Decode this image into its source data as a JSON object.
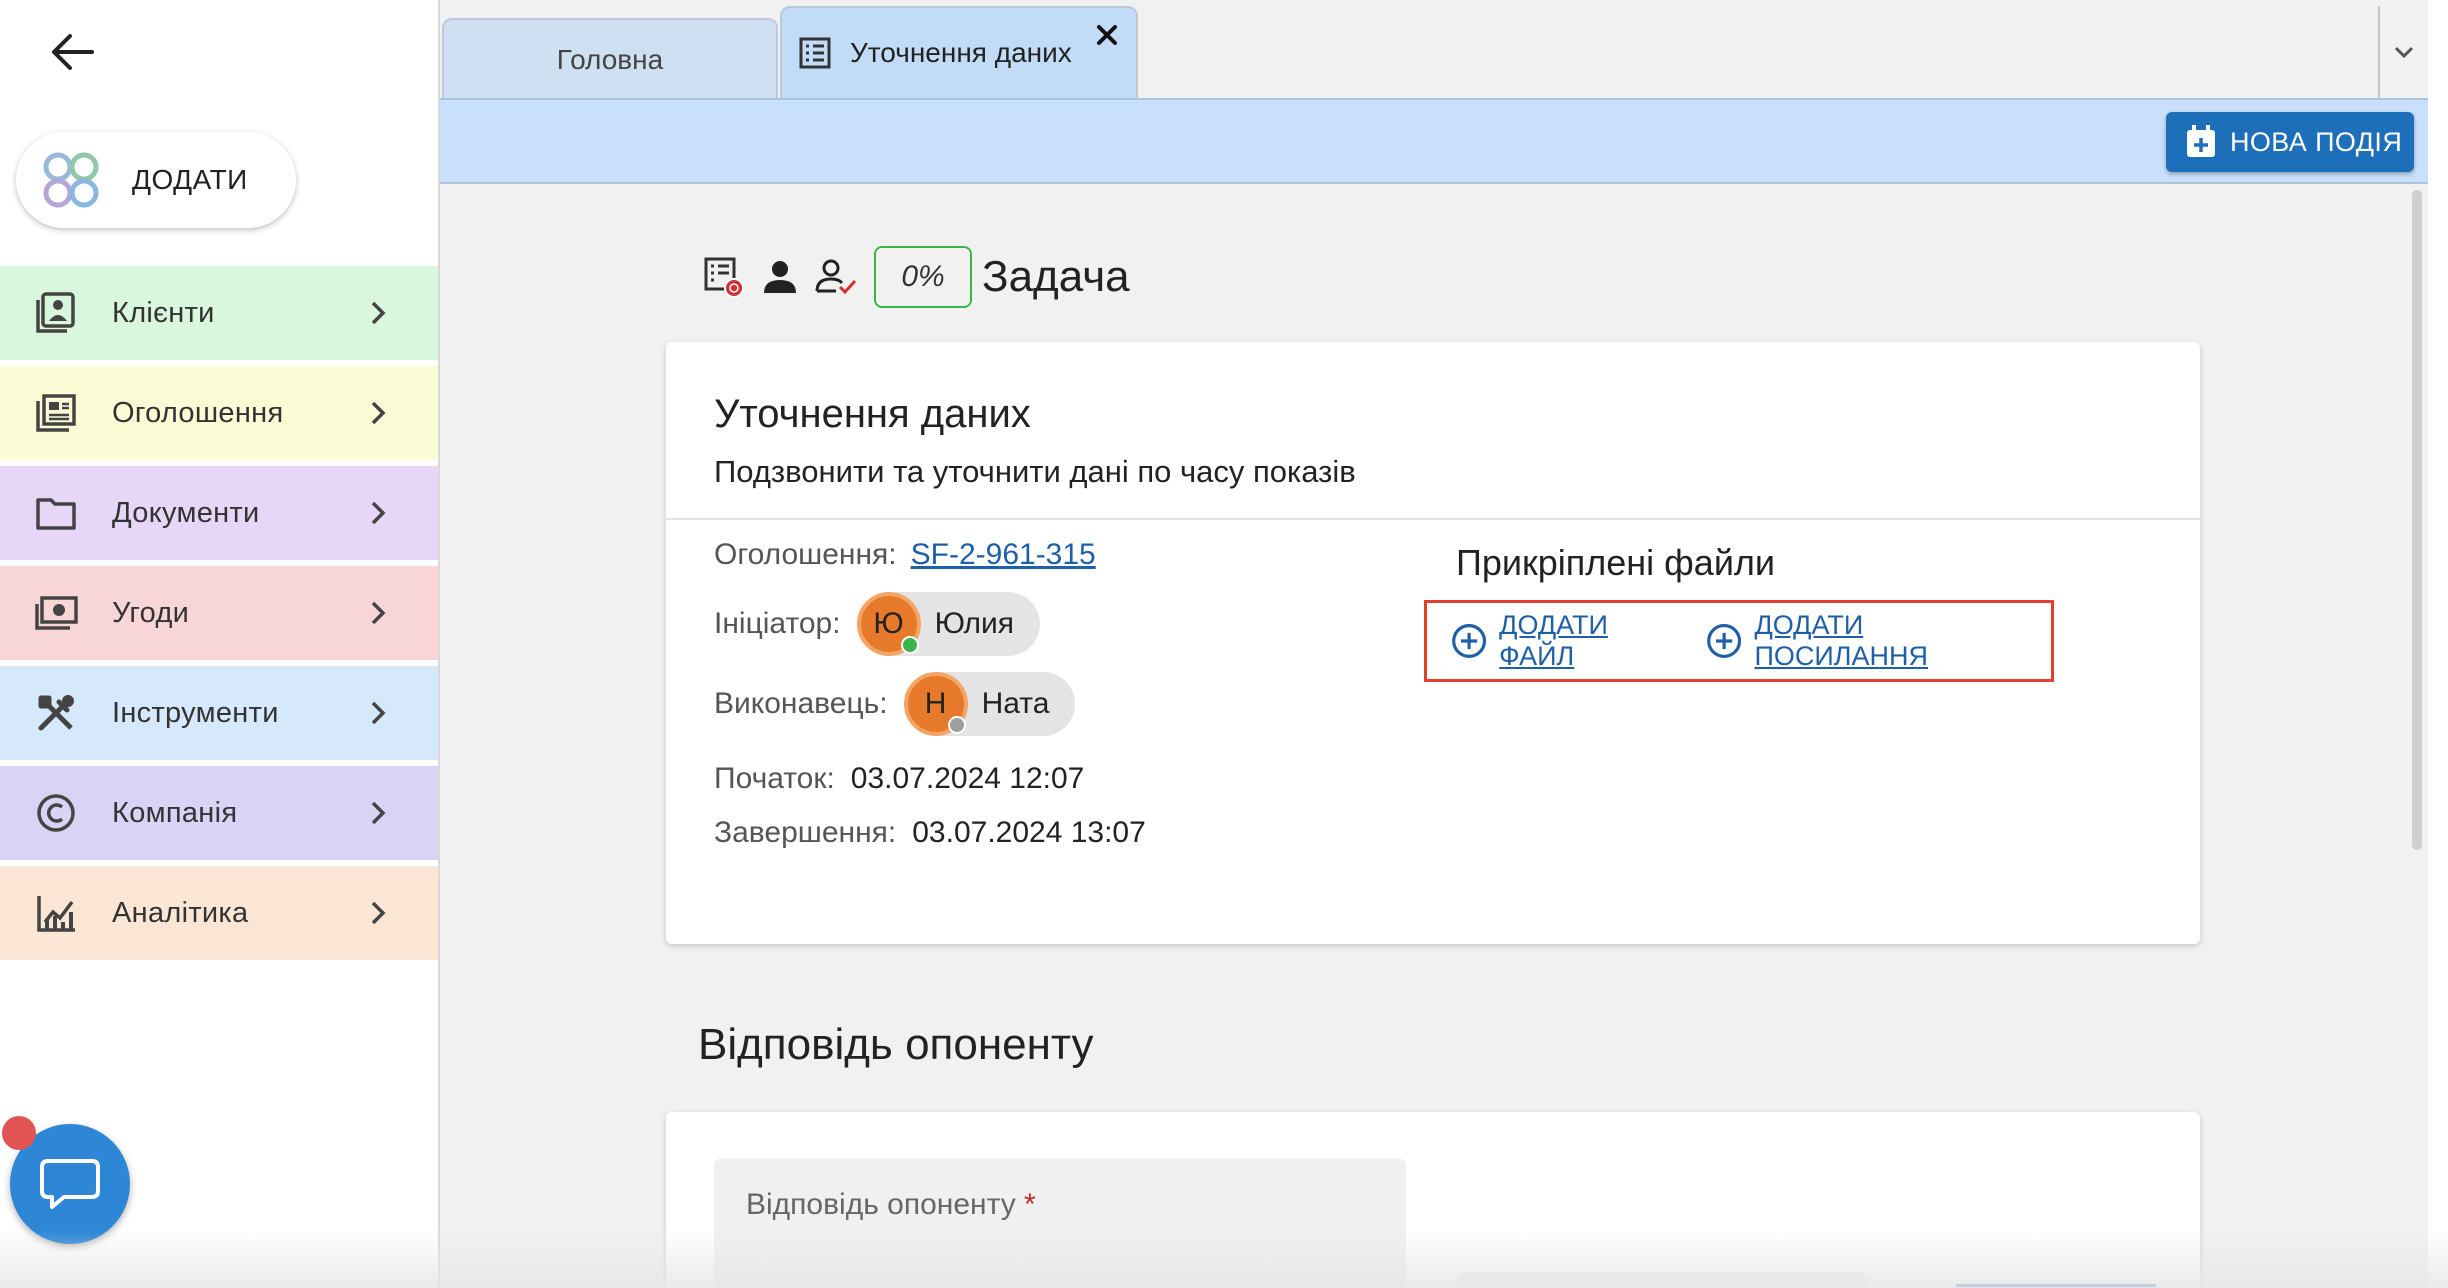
{
  "sidebar": {
    "add_label": "ДОДАТИ",
    "items": [
      {
        "label": "Клієнти",
        "color": "#d9f7dc"
      },
      {
        "label": "Оголошення",
        "color": "#fbfbd6"
      },
      {
        "label": "Документи",
        "color": "#e7d6f8"
      },
      {
        "label": "Угоди",
        "color": "#f8d6d8"
      },
      {
        "label": "Інструменти",
        "color": "#d6e8fb"
      },
      {
        "label": "Компанія",
        "color": "#d8d4f6"
      },
      {
        "label": "Аналітика",
        "color": "#fbe6d6"
      }
    ]
  },
  "tabs": {
    "home_label": "Головна",
    "active_label": "Уточнення даних"
  },
  "toolbar": {
    "new_event_label": "НОВА ПОДІЯ"
  },
  "task": {
    "progress": "0%",
    "type": "Задача",
    "title": "Уточнення даних",
    "description": "Подзвонити та уточнити дані по часу показів",
    "ad_label": "Оголошення:",
    "ad_value": "SF-2-961-315",
    "initiator_label": "Ініціатор:",
    "initiator_initial": "Ю",
    "initiator_name": "Юлия",
    "initiator_status_color": "#3ab54a",
    "executor_label": "Виконавець:",
    "executor_initial": "Н",
    "executor_name": "Ната",
    "executor_status_color": "#9e9e9e",
    "start_label": "Початок:",
    "start_value": "03.07.2024 12:07",
    "end_label": "Завершення:",
    "end_value": "03.07.2024 13:07"
  },
  "files": {
    "title": "Прикріплені файли",
    "add_file_label": "ДОДАТИ ФАЙЛ",
    "add_link_label": "ДОДАТИ ПОСИЛАННЯ"
  },
  "answer": {
    "section_title": "Відповідь опоненту",
    "field_label": "Відповідь опоненту",
    "required_mark": "*"
  }
}
